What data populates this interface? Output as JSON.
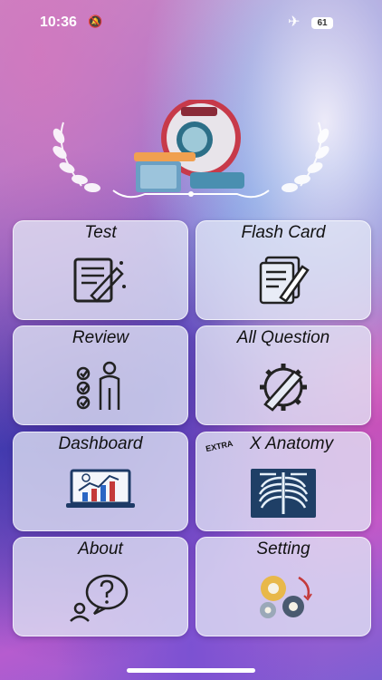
{
  "status_bar": {
    "time": "10:36",
    "battery": "61"
  },
  "menu": [
    {
      "label": "Test",
      "icon": "test-paper-icon"
    },
    {
      "label": "Flash Card",
      "icon": "flashcard-icon"
    },
    {
      "label": "Review",
      "icon": "checklist-person-icon"
    },
    {
      "label": "All Question",
      "icon": "gear-pencil-icon"
    },
    {
      "label": "Dashboard",
      "icon": "laptop-chart-icon"
    },
    {
      "label": "X Anatomy",
      "badge": "EXTRA",
      "icon": "chest-xray-icon"
    },
    {
      "label": "About",
      "icon": "question-bubble-icon"
    },
    {
      "label": "Setting",
      "icon": "gears-icon"
    }
  ]
}
